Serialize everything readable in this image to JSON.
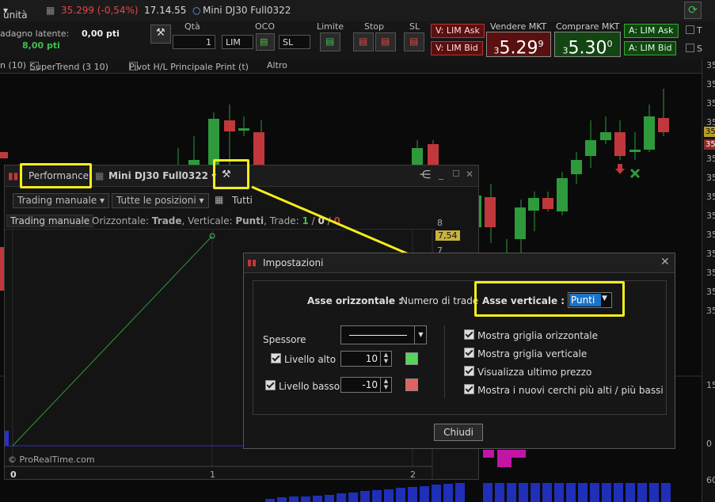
{
  "topbar": {
    "unit_select": "unità",
    "price_change": "35.299 (-0,54%)",
    "time": "17.14.55",
    "instrument": "Mini DJ30 Full0322"
  },
  "orderbar": {
    "latent_gain_label": "adagno latente:",
    "latent_gain_value": "0,00 pti",
    "gain_value": "8,00 pti",
    "qty_label": "Qtà",
    "qty_value": "1",
    "oco_label": "OCO",
    "lim_field": "LIM",
    "sl_field": "SL",
    "limite_label": "Limite",
    "stop_label": "Stop",
    "sl_label": "SL",
    "sell_ask": "V: LIM Ask",
    "sell_bid": "V: LIM Bid",
    "sell_mkt_label": "Vendere MKT",
    "sell_price_prefix": "3",
    "sell_price": "5.29",
    "sell_price_sup": "9",
    "buy_mkt_label": "Comprare MKT",
    "buy_price_prefix": "3",
    "buy_price": "5.30",
    "buy_price_sup": "0",
    "buy_ask": "A: LIM Ask",
    "buy_bid": "A: LIM Bid",
    "right_t": "T",
    "right_s": "S"
  },
  "indicators": {
    "item1": "n (10)",
    "item2": "SuperTrend (3 10)",
    "item3": "Pivot H/L Principale Print (t)",
    "item4": "Altro"
  },
  "right_scale": [
    "35",
    "35",
    "35",
    "35",
    "35",
    "35",
    "35",
    "35",
    "35",
    "35",
    "35",
    "35",
    "35",
    "15",
    "0",
    "60"
  ],
  "price_tags": {
    "tag1": "35",
    "tag2": "35"
  },
  "performance": {
    "tab": "Performance",
    "instrument": "Mini DJ30 Full0322",
    "mode_select": "Trading manuale",
    "positions_select": "Tutte le posizioni",
    "all_label": "Tutti",
    "subtitle": "Trading manuale",
    "horiz_label": "Orizzontale:",
    "horiz_value": "Trade",
    "vert_label": "Verticale:",
    "vert_value": "Punti",
    "trade_label": "Trade:",
    "trade_win": "1",
    "trade_mid": "0",
    "trade_loss": "0",
    "y_ticks": [
      "8",
      "7"
    ],
    "last_value": "7,54",
    "x_ticks": [
      "0",
      "1",
      "2"
    ],
    "watermark": "© ProRealTime.com"
  },
  "dialog": {
    "title": "Impostazioni",
    "horiz_axis_label": "Asse orizzontale :",
    "horiz_axis_value": "Numero di trade",
    "vert_axis_label": "Asse verticale :",
    "vert_axis_value": "Punti",
    "thickness_label": "Spessore",
    "high_level_label": "Livello alto",
    "high_level_value": "10",
    "low_level_label": "Livello basso",
    "low_level_value": "-10",
    "opt1": "Mostra griglia orizzontale",
    "opt2": "Mostra griglia verticale",
    "opt3": "Visualizza ultimo prezzo",
    "opt4": "Mostra i nuovi cerchi più alti / più bassi",
    "close_button": "Chiudi"
  },
  "colors": {
    "high_level_swatch": "#55d65a",
    "low_level_swatch": "#e06262",
    "highlight": "#f4ee1a",
    "bull": "#2e9a3c",
    "bear": "#c0383c"
  }
}
